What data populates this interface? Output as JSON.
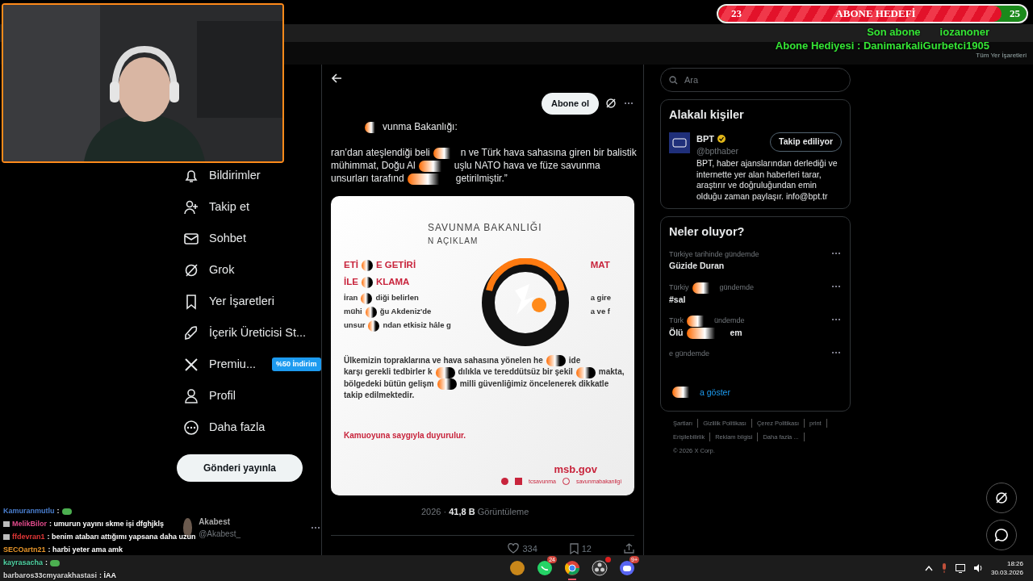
{
  "browser": {
    "bookmarks_label": "Tüm Yer İşaretleri"
  },
  "stream_overlay": {
    "goal": {
      "title": "ABONE HEDEFİ",
      "current": "23",
      "target": "25",
      "level": 0.92
    },
    "last_sub": {
      "label": "Son abone",
      "name": "iozanoner"
    },
    "gift": "Abone Hediyesi : DanimarkaliGurbetci1905"
  },
  "chat": [
    {
      "user": "Kamuranmutlu",
      "color": "#4a7fd0",
      "kind": "emote",
      "badged": false,
      "message": ":"
    },
    {
      "user": "MelikBilor",
      "color": "#e04a8a",
      "kind": "text",
      "badged": true,
      "message": ": umurun yayını skme işi dfghjklş"
    },
    {
      "user": "ffdevran1",
      "color": "#e03636",
      "kind": "text",
      "badged": true,
      "message": ": benim atabarı attığımı yapsana daha uzun"
    },
    {
      "user": "SECOartn21",
      "color": "#e8962a",
      "kind": "text",
      "badged": false,
      "message": ": harbi yeter ama amk"
    },
    {
      "user": "kayrasacha",
      "color": "#52d6a6",
      "kind": "emote",
      "badged": false,
      "message": ":"
    },
    {
      "user": "barbaros33cmyarakhastasi",
      "color": "#dcdcdc",
      "kind": "text",
      "badged": false,
      "message": ": İAA"
    }
  ],
  "nav": {
    "items": [
      {
        "label": "Bildirimler"
      },
      {
        "label": "Takip et"
      },
      {
        "label": "Sohbet"
      },
      {
        "label": "Grok"
      },
      {
        "label": "Yer İşaretleri"
      },
      {
        "label": "İçerik Üreticisi St..."
      },
      {
        "label": "Premiu...",
        "badge": "%50 İndirim"
      },
      {
        "label": "Profil"
      },
      {
        "label": "Daha fazla"
      }
    ],
    "post_button": "Gönderi yayınla",
    "account": {
      "name": "Akabest",
      "handle": "@Akabest_"
    }
  },
  "tweet": {
    "subscribe": "Abone ol",
    "author": "vunma Bakanlığı:",
    "lines": [
      [
        "ran’dan ateşlendiği beli",
        "n ve Türk hava sahasına giren bir balistik"
      ],
      [
        "mühimmat, Doğu Al",
        "uşlu NATO hava ve füze savunma"
      ],
      [
        "unsurları tarafınd",
        "getirilmiştir.”"
      ]
    ],
    "image": {
      "header": "SAVUNMA BAKANLIĞI",
      "subheader": "N AÇIKLAM",
      "middle": [
        {
          "kind": "title",
          "left": [
            "ETİ",
            "E GETİRİ"
          ],
          "right": [
            "MAT"
          ]
        },
        {
          "kind": "title",
          "left": [
            "İLE",
            "KLAMA"
          ]
        },
        {
          "kind": "body",
          "left": [
            "İran",
            "diği belirlen"
          ],
          "right": [
            "a gire"
          ]
        },
        {
          "kind": "body",
          "left": [
            "mühi",
            "ğu Akdeniz'de"
          ],
          "right": [
            "a ve f"
          ]
        },
        {
          "kind": "body",
          "left": [
            "unsur",
            "ndan etkisiz hâle g"
          ]
        }
      ],
      "paragraph": [
        [
          "Ülkemizin topraklarına ve hava sahasına yönelen he",
          "ide"
        ],
        [
          "karşı gerekli tedbirler k",
          "dılıkla ve tereddütsüz bir şekil",
          "makta,"
        ],
        [
          "bölgedeki bütün gelişm",
          "milli güvenliğimiz öncelenerek dikkatle"
        ],
        [
          "takip edilmektedir."
        ]
      ],
      "closing": "Kamuoyuna saygıyla duyurulur.",
      "site": "msb.gov",
      "socials": [
        "tcsavunma",
        "savunmabakanligi"
      ]
    },
    "meta": "2026 · **41,8 B** Görüntüleme",
    "likes": "334",
    "bookmarks": "12"
  },
  "search": {
    "placeholder": "Ara"
  },
  "relevant": {
    "title": "Alakalı kişiler",
    "name": "BPT",
    "handle": "@bpthaber",
    "verified": true,
    "follow": "Takip ediliyor",
    "bio": "BPT, haber ajanslarından derlediği ve internette yer alan haberleri tarar, araştırır ve doğruluğundan emin olduğu zaman paylaşır. info@bpt.tr"
  },
  "trends": {
    "title": "Neler oluyor?",
    "items": [
      {
        "category": [
          "Türkiye tarihinde gündemde"
        ],
        "name": [
          "Güzide Duran"
        ]
      },
      {
        "category": [
          "Türkiy",
          "gündemde"
        ],
        "name": [
          "#sal"
        ]
      },
      {
        "category": [
          "Türk",
          "ündemde"
        ],
        "name": [
          "Ölü",
          "em"
        ]
      },
      {
        "category": [
          "e gündemde"
        ]
      }
    ],
    "show_more": "a göster"
  },
  "footer": {
    "links": [
      "Şartları",
      "Gizlilik Politikası",
      "Çerez Politikası",
      "print",
      "Erişilebilirlik",
      "Reklam bilgisi",
      "Daha fazla ..."
    ],
    "copyright": "© 2026 X Corp."
  },
  "taskbar": {
    "apps": [
      {
        "notified": false
      },
      {
        "badge": "24",
        "notified": false
      },
      {
        "notified": false,
        "running": true
      },
      {
        "notified": true
      },
      {
        "badge": "9+",
        "notified": false
      }
    ],
    "time": "18:26",
    "date": "30.03.2026"
  }
}
